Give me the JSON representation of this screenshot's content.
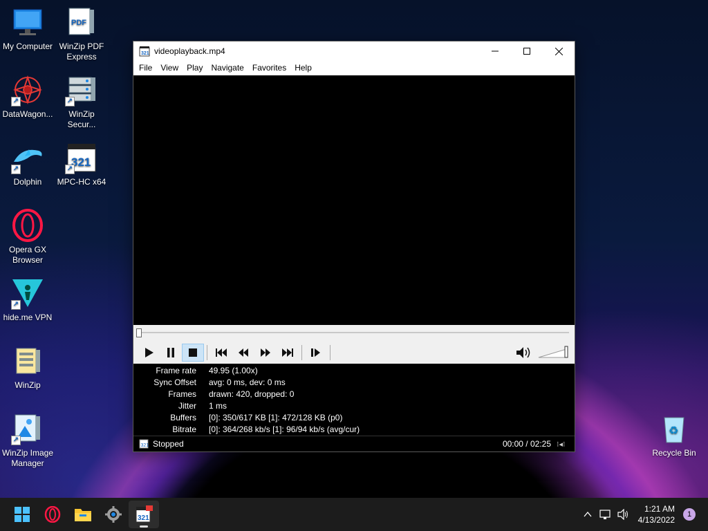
{
  "desktop": {
    "icons": [
      {
        "label": "My Computer"
      },
      {
        "label": "WinZip PDF Express"
      },
      {
        "label": "DataWagon..."
      },
      {
        "label": "WinZip Secur..."
      },
      {
        "label": "Dolphin"
      },
      {
        "label": "MPC-HC x64"
      },
      {
        "label": "Opera GX Browser"
      },
      {
        "label": "hide.me VPN"
      },
      {
        "label": "WinZip"
      },
      {
        "label": "WinZip Image Manager"
      },
      {
        "label": "Recycle Bin"
      }
    ]
  },
  "window": {
    "title": "videoplayback.mp4",
    "menu": [
      "File",
      "View",
      "Play",
      "Navigate",
      "Favorites",
      "Help"
    ],
    "stats": [
      {
        "label": "Frame rate",
        "value": "49.95 (1.00x)"
      },
      {
        "label": "Sync Offset",
        "value": "avg: 0 ms, dev: 0 ms"
      },
      {
        "label": "Frames",
        "value": "drawn: 420, dropped: 0"
      },
      {
        "label": "Jitter",
        "value": "1 ms"
      },
      {
        "label": "Buffers",
        "value": "[0]: 350/617 KB [1]: 472/128 KB (p0)"
      },
      {
        "label": "Bitrate",
        "value": "[0]: 364/268 kb/s [1]: 96/94 kb/s (avg/cur)"
      }
    ],
    "status": "Stopped",
    "time": "00:00 / 02:25",
    "seek_position": 0,
    "volume_level": 1
  },
  "taskbar": {
    "time": "1:21 AM",
    "date": "4/13/2022",
    "notification_count": "1"
  },
  "colors": {
    "accent": "#cce4f7",
    "taskbar": "#1c1c1c"
  }
}
